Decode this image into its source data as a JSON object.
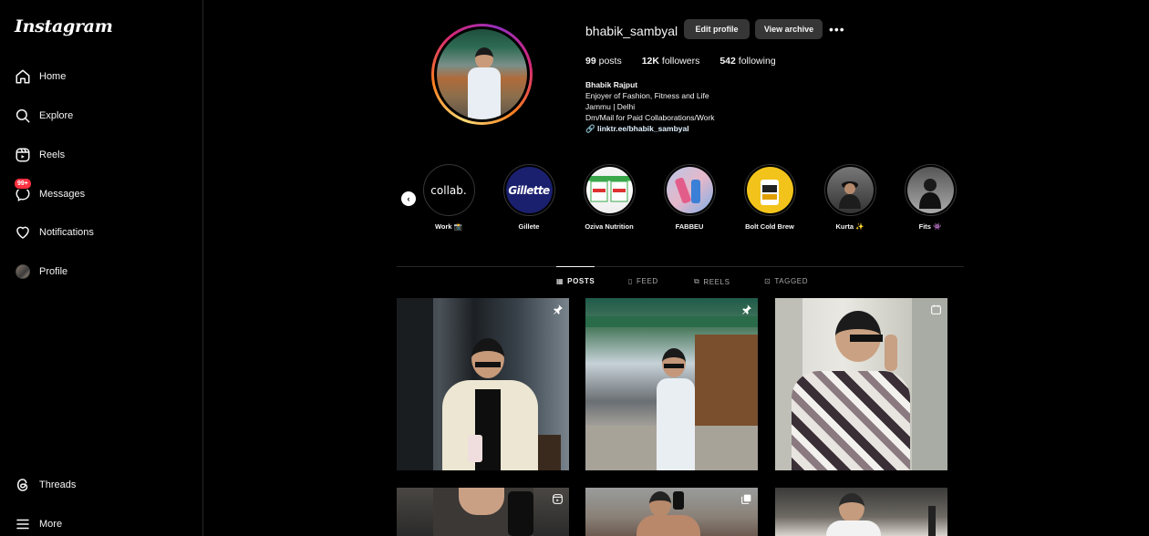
{
  "app": {
    "logo": "Instagram"
  },
  "sidebar": {
    "items": [
      {
        "label": "Home",
        "icon": "home-icon"
      },
      {
        "label": "Explore",
        "icon": "search-icon"
      },
      {
        "label": "Reels",
        "icon": "reels-icon"
      },
      {
        "label": "Messages",
        "icon": "messenger-icon",
        "badge": "99+"
      },
      {
        "label": "Notifications",
        "icon": "heart-icon"
      },
      {
        "label": "Profile",
        "icon": "avatar"
      }
    ],
    "bottom": [
      {
        "label": "Threads",
        "icon": "threads-icon"
      },
      {
        "label": "More",
        "icon": "menu-icon"
      }
    ]
  },
  "profile": {
    "username": "bhabik_sambyal",
    "edit_label": "Edit profile",
    "archive_label": "View archive",
    "stats": {
      "posts_count": "99",
      "posts_label": "posts",
      "followers_count": "12K",
      "followers_label": "followers",
      "following_count": "542",
      "following_label": "following"
    },
    "bio": {
      "name": "Bhabik Rajput",
      "lines": [
        "Enjoyer of Fashion, Fitness and Life",
        "Jammu | Delhi",
        "Dm/Mail for Paid Collaborations/Work"
      ],
      "link": "linktr.ee/bhabik_sambyal"
    }
  },
  "highlights": [
    {
      "label": "Work 📸",
      "text": "collab."
    },
    {
      "label": "Gillete",
      "text": "Gillette"
    },
    {
      "label": "Oziva Nutrition",
      "text": ""
    },
    {
      "label": "FABBEU",
      "text": ""
    },
    {
      "label": "Bolt Cold Brew",
      "text": ""
    },
    {
      "label": "Kurta ✨",
      "text": ""
    },
    {
      "label": "Fits 👾",
      "text": ""
    }
  ],
  "tabs": [
    {
      "label": "POSTS",
      "active": true
    },
    {
      "label": "FEED",
      "active": false
    },
    {
      "label": "REELS",
      "active": false
    },
    {
      "label": "TAGGED",
      "active": false
    }
  ],
  "posts": [
    {
      "overlay_icon": "pin-icon"
    },
    {
      "overlay_icon": "pin-icon"
    },
    {
      "overlay_icon": "clip-icon"
    },
    {
      "overlay_icon": "reel-icon"
    },
    {
      "overlay_icon": "carousel-icon"
    },
    {
      "overlay_icon": ""
    }
  ]
}
